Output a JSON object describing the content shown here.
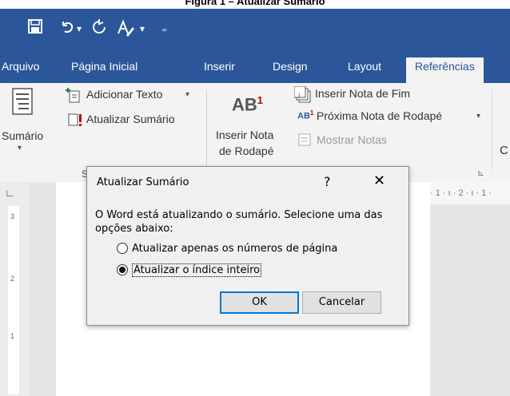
{
  "caption": "Figura 1 – Atualizar Sumário",
  "quick_access": {
    "save_icon": "save-icon",
    "undo_icon": "undo-icon",
    "redo_icon": "redo-icon",
    "format_icon": "font-format-icon",
    "dropdown_glyph": "▾",
    "customize_glyph": "₌"
  },
  "tabs": [
    "Arquivo",
    "Página Inicial",
    "Inserir",
    "Design",
    "Layout",
    "Referências"
  ],
  "active_tab": "Referências",
  "ribbon": {
    "toc_group": {
      "sumario": "Sumário",
      "adicionar_texto": "Adicionar Texto",
      "atualizar_sumario": "Atualizar Sumário",
      "group_label": "S"
    },
    "footnotes_group": {
      "ab_label": "AB",
      "ab_sup": "1",
      "inserir_nota_1": "Inserir Nota",
      "inserir_nota_2": "de Rodapé",
      "inserir_nota_fim": "Inserir Nota de Fim",
      "proxima_nota": "Próxima Nota de Rodapé",
      "mostrar_notas": "Mostrar Notas",
      "expand_glyph": "⊾"
    },
    "next_group_letter": "C",
    "dropdown_arrow": "▾"
  },
  "ruler": {
    "corner_glyph": "∟",
    "top_text": "· 1 · ı · 2 · ı · 1 ·",
    "left_marks": [
      "3",
      "2",
      "1"
    ]
  },
  "dialog": {
    "title": "Atualizar Sumário",
    "help_label": "?",
    "close_label": "✕",
    "message": "O Word está atualizando o sumário. Selecione uma das opções abaixo:",
    "option1": "Atualizar apenas os números de página",
    "option2": "Atualizar o índice inteiro",
    "selected_option": 2,
    "ok_label": "OK",
    "cancel_label": "Cancelar"
  },
  "colors": {
    "word_blue": "#2b579a",
    "ribbon_bg": "#f3f3f3",
    "dialog_bg": "#f0f0f0",
    "focus_blue": "#0078d7",
    "red_mark": "#c00000"
  }
}
